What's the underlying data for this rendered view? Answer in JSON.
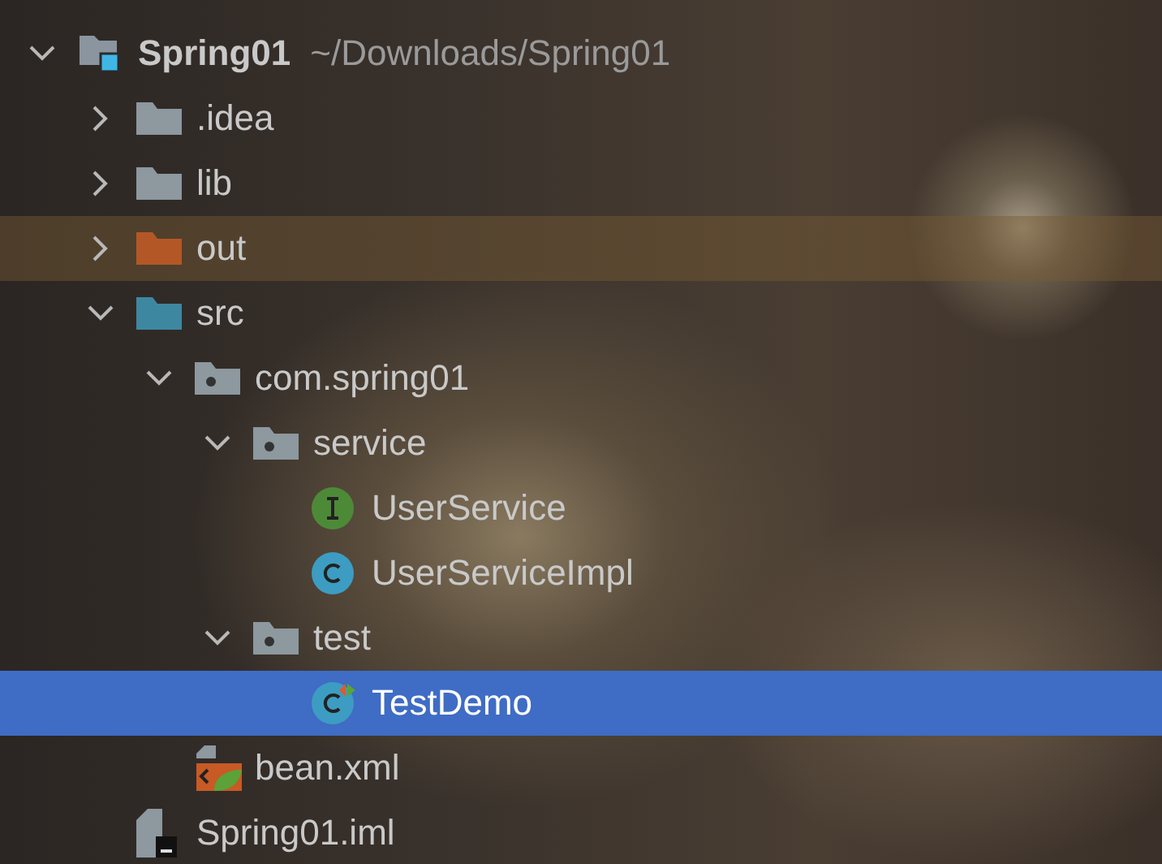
{
  "project_tree": [
    {
      "label": "Spring01",
      "path": "~/Downloads/Spring01",
      "kind": "module",
      "expanded": true,
      "selected": false,
      "highlighted": false,
      "children": [
        {
          "label": ".idea",
          "kind": "folder",
          "expanded": false,
          "selected": false,
          "highlighted": false
        },
        {
          "label": "lib",
          "kind": "folder",
          "expanded": false,
          "selected": false,
          "highlighted": false
        },
        {
          "label": "out",
          "kind": "excluded-folder",
          "expanded": false,
          "selected": false,
          "highlighted": true
        },
        {
          "label": "src",
          "kind": "source-folder",
          "expanded": true,
          "selected": false,
          "highlighted": false,
          "children": [
            {
              "label": "com.spring01",
              "kind": "package",
              "expanded": true,
              "selected": false,
              "highlighted": false,
              "children": [
                {
                  "label": "service",
                  "kind": "package",
                  "expanded": true,
                  "selected": false,
                  "highlighted": false,
                  "children": [
                    {
                      "label": "UserService",
                      "kind": "interface",
                      "selected": false,
                      "highlighted": false
                    },
                    {
                      "label": "UserServiceImpl",
                      "kind": "class",
                      "selected": false,
                      "highlighted": false
                    }
                  ]
                },
                {
                  "label": "test",
                  "kind": "package",
                  "expanded": true,
                  "selected": false,
                  "highlighted": false,
                  "children": [
                    {
                      "label": "TestDemo",
                      "kind": "runnable-class",
                      "selected": true,
                      "highlighted": false
                    }
                  ]
                }
              ]
            },
            {
              "label": "bean.xml",
              "kind": "spring-xml",
              "selected": false,
              "highlighted": false
            }
          ]
        },
        {
          "label": "Spring01.iml",
          "kind": "iml",
          "selected": false,
          "highlighted": false
        }
      ]
    }
  ]
}
